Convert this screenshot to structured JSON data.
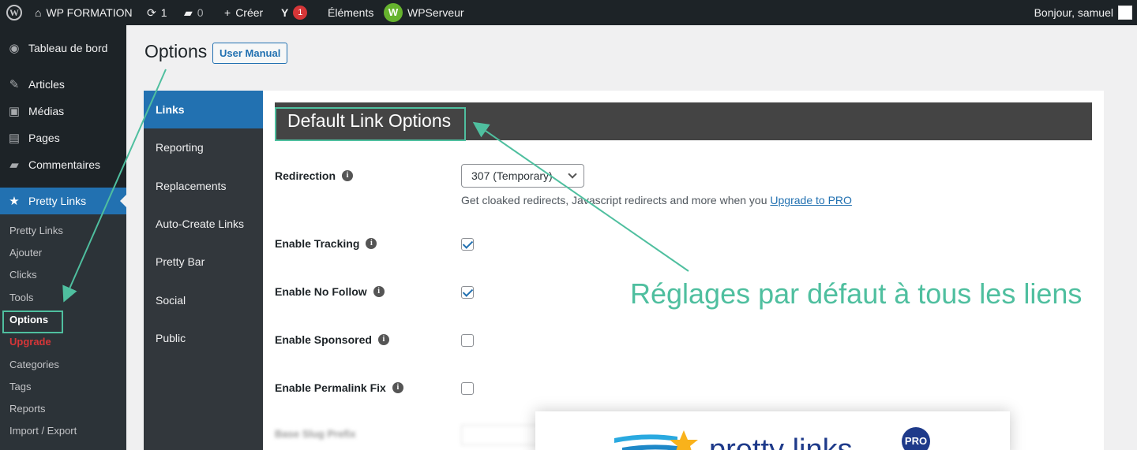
{
  "adminbar": {
    "site_name": "WP FORMATION",
    "updates_count": "1",
    "comments_count": "0",
    "new_label": "Créer",
    "yoast_badge": "1",
    "elements_label": "Éléments",
    "wpserveur_label": "WPServeur",
    "greeting": "Bonjour, samuel"
  },
  "sidebar": {
    "items": [
      {
        "label": "Tableau de bord",
        "icon": "dashboard-icon"
      },
      {
        "label": "Articles",
        "icon": "pin-icon"
      },
      {
        "label": "Médias",
        "icon": "media-icon"
      },
      {
        "label": "Pages",
        "icon": "pages-icon"
      },
      {
        "label": "Commentaires",
        "icon": "comment-icon"
      },
      {
        "label": "Pretty Links",
        "icon": "star-icon"
      }
    ],
    "submenu": [
      "Pretty Links",
      "Ajouter",
      "Clicks",
      "Tools",
      "Options",
      "Upgrade",
      "Categories",
      "Tags",
      "Reports",
      "Import / Export"
    ]
  },
  "page": {
    "title": "Options",
    "manual_button": "User Manual"
  },
  "tabs": [
    "Links",
    "Reporting",
    "Replacements",
    "Auto-Create Links",
    "Pretty Bar",
    "Social",
    "Public"
  ],
  "panel": {
    "header_title": "Default Link Options",
    "redirection_label": "Redirection",
    "redirection_value": "307 (Temporary)",
    "help_text": "Get cloaked redirects, Javascript redirects and more when you",
    "help_link": "Upgrade to PRO",
    "rows": [
      {
        "label": "Enable Tracking",
        "checked": true
      },
      {
        "label": "Enable No Follow",
        "checked": true
      },
      {
        "label": "Enable Sponsored",
        "checked": false
      },
      {
        "label": "Enable Permalink Fix",
        "checked": false
      }
    ],
    "blurred_label": "Base Slug Prefix"
  },
  "annotation": "Réglages par défaut à tous les liens",
  "promo": {
    "logo_text": "pretty links",
    "pro_badge": "PRO"
  },
  "colors": {
    "admin_dark": "#1d2327",
    "accent_blue": "#2271b1",
    "annotation_green": "#4fbf9f",
    "upgrade_red": "#d63638"
  }
}
